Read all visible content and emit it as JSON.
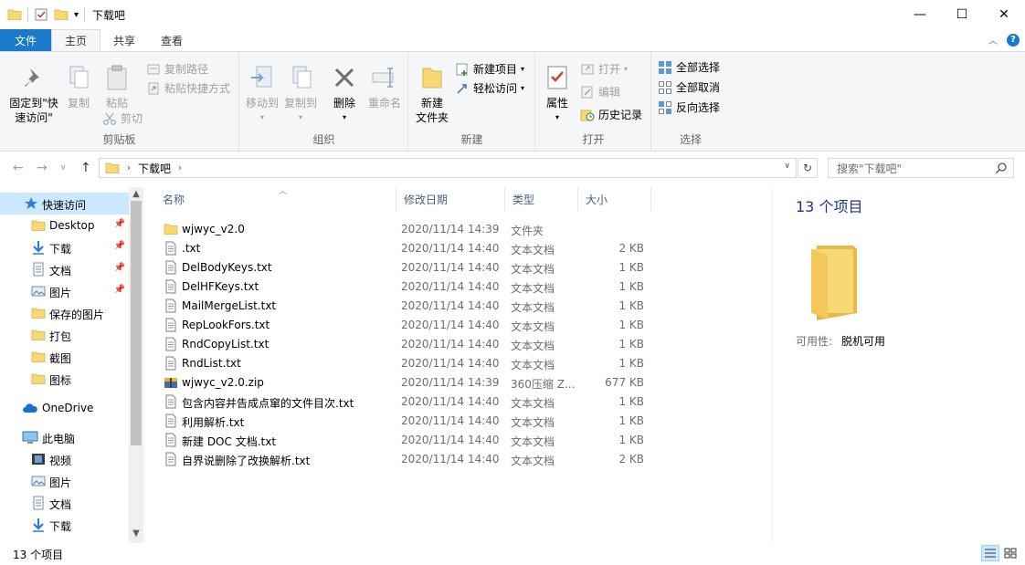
{
  "window": {
    "title": "下载吧",
    "controls": {
      "minimize": "—",
      "maximize": "☐",
      "close": "✕"
    }
  },
  "tabs": {
    "file": "文件",
    "home": "主页",
    "share": "共享",
    "view": "查看"
  },
  "ribbon": {
    "clipboard": {
      "label": "剪贴板",
      "pin": "固定到\"快速访问\"",
      "copy": "复制",
      "paste": "粘贴",
      "copy_path": "复制路径",
      "paste_shortcut": "粘贴快捷方式",
      "cut": "剪切"
    },
    "organize": {
      "label": "组织",
      "move_to": "移动到",
      "copy_to": "复制到",
      "delete": "删除",
      "rename": "重命名"
    },
    "new": {
      "label": "新建",
      "new_folder": "新建\n文件夹",
      "new_item": "新建项目",
      "easy_access": "轻松访问"
    },
    "open": {
      "label": "打开",
      "properties": "属性",
      "open": "打开",
      "edit": "编辑",
      "history": "历史记录"
    },
    "select": {
      "label": "选择",
      "select_all": "全部选择",
      "select_none": "全部取消",
      "invert": "反向选择"
    }
  },
  "address": {
    "path": "下载吧",
    "search_placeholder": "搜索\"下载吧\""
  },
  "navpane": {
    "items": [
      {
        "label": "快速访问",
        "icon": "star-icon",
        "pinned": false,
        "selected": true
      },
      {
        "label": "Desktop",
        "icon": "folder-icon",
        "pinned": true
      },
      {
        "label": "下载",
        "icon": "download-icon",
        "pinned": true
      },
      {
        "label": "文档",
        "icon": "document-icon",
        "pinned": true
      },
      {
        "label": "图片",
        "icon": "picture-icon",
        "pinned": true
      },
      {
        "label": "保存的图片",
        "icon": "folder-icon",
        "pinned": false
      },
      {
        "label": "打包",
        "icon": "folder-icon",
        "pinned": false
      },
      {
        "label": "截图",
        "icon": "folder-icon",
        "pinned": false
      },
      {
        "label": "图标",
        "icon": "folder-icon",
        "pinned": false
      },
      {
        "label": "OneDrive",
        "icon": "cloud-icon",
        "pinned": false
      },
      {
        "label": "此电脑",
        "icon": "computer-icon",
        "pinned": false
      },
      {
        "label": "视频",
        "icon": "video-icon",
        "pinned": false
      },
      {
        "label": "图片",
        "icon": "picture-icon",
        "pinned": false
      },
      {
        "label": "文档",
        "icon": "document-icon",
        "pinned": false
      },
      {
        "label": "下载",
        "icon": "download-icon",
        "pinned": false
      }
    ]
  },
  "columns": {
    "name": "名称",
    "date": "修改日期",
    "type": "类型",
    "size": "大小"
  },
  "files": [
    {
      "name": "wjwyc_v2.0",
      "date": "2020/11/14 14:39",
      "type": "文件夹",
      "size": "",
      "icon": "folder-icon"
    },
    {
      "name": ".txt",
      "date": "2020/11/14 14:40",
      "type": "文本文档",
      "size": "2 KB",
      "icon": "text-file-icon"
    },
    {
      "name": "DelBodyKeys.txt",
      "date": "2020/11/14 14:40",
      "type": "文本文档",
      "size": "1 KB",
      "icon": "text-file-icon"
    },
    {
      "name": "DelHFKeys.txt",
      "date": "2020/11/14 14:40",
      "type": "文本文档",
      "size": "1 KB",
      "icon": "text-file-icon"
    },
    {
      "name": "MailMergeList.txt",
      "date": "2020/11/14 14:40",
      "type": "文本文档",
      "size": "1 KB",
      "icon": "text-file-icon"
    },
    {
      "name": "RepLookFors.txt",
      "date": "2020/11/14 14:40",
      "type": "文本文档",
      "size": "1 KB",
      "icon": "text-file-icon"
    },
    {
      "name": "RndCopyList.txt",
      "date": "2020/11/14 14:40",
      "type": "文本文档",
      "size": "1 KB",
      "icon": "text-file-icon"
    },
    {
      "name": "RndList.txt",
      "date": "2020/11/14 14:40",
      "type": "文本文档",
      "size": "1 KB",
      "icon": "text-file-icon"
    },
    {
      "name": "wjwyc_v2.0.zip",
      "date": "2020/11/14 14:39",
      "type": "360压缩 Z...",
      "size": "677 KB",
      "icon": "zip-archive-icon"
    },
    {
      "name": "包含内容并告成点窜的文件目次.txt",
      "date": "2020/11/14 14:40",
      "type": "文本文档",
      "size": "1 KB",
      "icon": "text-file-icon"
    },
    {
      "name": "利用解析.txt",
      "date": "2020/11/14 14:40",
      "type": "文本文档",
      "size": "1 KB",
      "icon": "text-file-icon"
    },
    {
      "name": "新建 DOC 文档.txt",
      "date": "2020/11/14 14:40",
      "type": "文本文档",
      "size": "1 KB",
      "icon": "text-file-icon"
    },
    {
      "name": "自界说删除了改换解析.txt",
      "date": "2020/11/14 14:40",
      "type": "文本文档",
      "size": "2 KB",
      "icon": "text-file-icon"
    }
  ],
  "details": {
    "count": "13 个项目",
    "availability_label": "可用性:",
    "availability_value": "脱机可用"
  },
  "status": {
    "text": "13 个项目"
  },
  "colors": {
    "accent": "#1979ca",
    "folder": "#f8d775",
    "selected": "#cce8ff"
  }
}
